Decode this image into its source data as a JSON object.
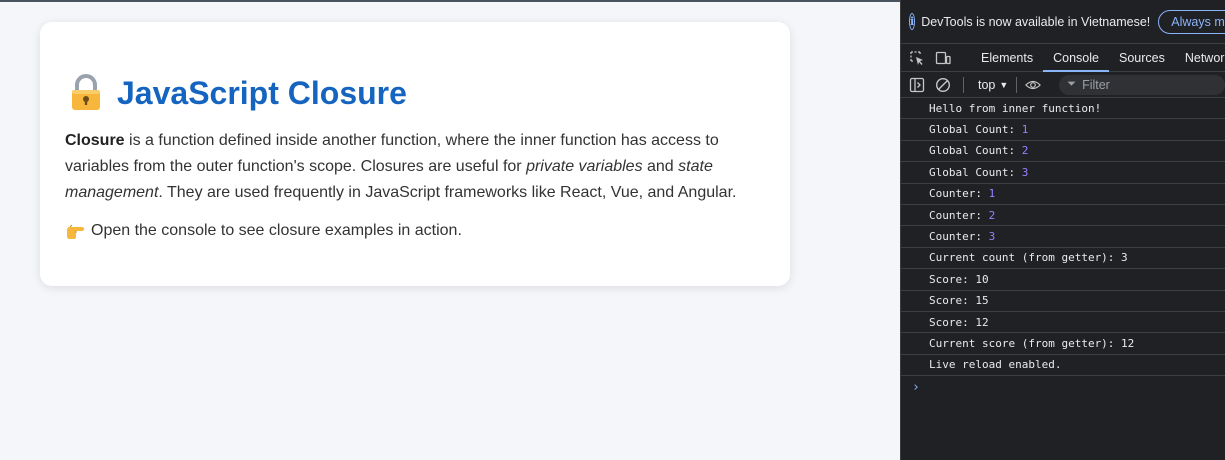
{
  "page": {
    "title": "JavaScript Closure",
    "desc_bold": "Closure",
    "desc_part1": " is a function defined inside another function, where the inner function has access to variables from the outer function's scope. Closures are useful for ",
    "desc_em1": "private variables",
    "desc_part2": " and ",
    "desc_em2": "state management",
    "desc_part3": ". They are used frequently in JavaScript frameworks like React, Vue, and Angular.",
    "hint": "Open the console to see closure examples in action.",
    "title_icon": "lock-icon",
    "hint_icon": "pointing-hand-icon",
    "accent_color": "#1565c0"
  },
  "devtools": {
    "info_text": "DevTools is now available in Vietnamese!",
    "always_button": "Always ma",
    "tabs": [
      {
        "label": "Elements",
        "active": false
      },
      {
        "label": "Console",
        "active": true
      },
      {
        "label": "Sources",
        "active": false
      },
      {
        "label": "Network",
        "active": false
      }
    ],
    "context": "top",
    "filter_placeholder": "Filter",
    "logs": [
      {
        "text": "Hello from inner function!",
        "num": ""
      },
      {
        "text": "Global Count: ",
        "num": "1"
      },
      {
        "text": "Global Count: ",
        "num": "2"
      },
      {
        "text": "Global Count: ",
        "num": "3"
      },
      {
        "text": "Counter: ",
        "num": "1"
      },
      {
        "text": "Counter: ",
        "num": "2"
      },
      {
        "text": "Counter: ",
        "num": "3"
      },
      {
        "text": "Current count (from getter): 3",
        "num": ""
      },
      {
        "text": "Score: 10",
        "num": ""
      },
      {
        "text": "Score: 15",
        "num": ""
      },
      {
        "text": "Score: 12",
        "num": ""
      },
      {
        "text": "Current score (from getter): 12",
        "num": ""
      },
      {
        "text": "Live reload enabled.",
        "num": ""
      }
    ],
    "prompt": "›"
  }
}
